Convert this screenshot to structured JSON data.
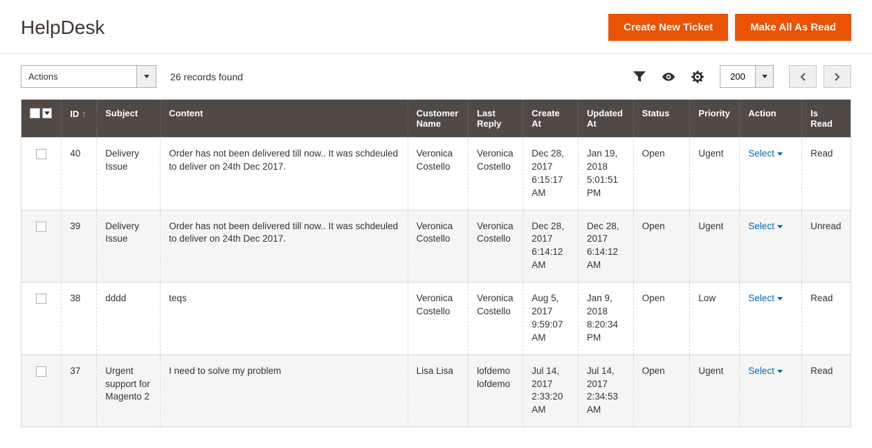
{
  "header": {
    "title": "HelpDesk",
    "create_ticket_label": "Create New Ticket",
    "make_read_label": "Make All As Read"
  },
  "toolbar": {
    "actions_placeholder": "Actions",
    "records_found": "26 records found",
    "per_page": "200"
  },
  "columns": {
    "id": "ID",
    "subject": "Subject",
    "content": "Content",
    "customer_name": "Customer Name",
    "last_reply": "Last Reply",
    "create_at": "Create At",
    "updated_at": "Updated At",
    "status": "Status",
    "priority": "Priority",
    "action": "Action",
    "is_read": "Is Read"
  },
  "action_label": "Select",
  "rows": [
    {
      "id": "40",
      "subject": "Delivery Issue",
      "content": "Order has not been delivered till now.. It was schdeuled to deliver on 24th Dec 2017.",
      "customer_name": "Veronica Costello",
      "last_reply": "Veronica Costello",
      "create_at": "Dec 28, 2017 6:15:17 AM",
      "updated_at": "Jan 19, 2018 5:01:51 PM",
      "status": "Open",
      "priority": "Ugent",
      "is_read": "Read"
    },
    {
      "id": "39",
      "subject": "Delivery Issue",
      "content": "Order has not been delivered till now.. It was schdeuled to deliver on 24th Dec 2017.",
      "customer_name": "Veronica Costello",
      "last_reply": "Veronica Costello",
      "create_at": "Dec 28, 2017 6:14:12 AM",
      "updated_at": "Dec 28, 2017 6:14:12 AM",
      "status": "Open",
      "priority": "Ugent",
      "is_read": "Unread"
    },
    {
      "id": "38",
      "subject": "dddd",
      "content": "teqs",
      "customer_name": "Veronica Costello",
      "last_reply": "Veronica Costello",
      "create_at": "Aug 5, 2017 9:59:07 AM",
      "updated_at": "Jan 9, 2018 8:20:34 PM",
      "status": "Open",
      "priority": "Low",
      "is_read": "Read"
    },
    {
      "id": "37",
      "subject": "Urgent support for Magento 2",
      "content": "I need to solve my problem",
      "customer_name": "Lisa Lisa",
      "last_reply": "lofdemo lofdemo",
      "create_at": "Jul 14, 2017 2:33:20 AM",
      "updated_at": "Jul 14, 2017 2:34:53 AM",
      "status": "Open",
      "priority": "Ugent",
      "is_read": "Read"
    }
  ]
}
